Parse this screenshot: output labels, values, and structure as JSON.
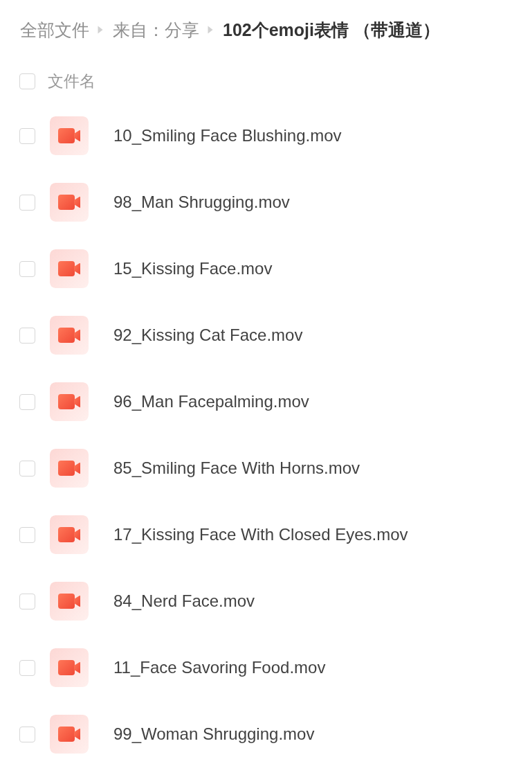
{
  "breadcrumb": [
    {
      "label": "全部文件",
      "current": false
    },
    {
      "label": "来自：分享",
      "current": false
    },
    {
      "label": "102个emoji表情 （带通道）",
      "current": true
    }
  ],
  "header": {
    "checked": false,
    "label": "文件名"
  },
  "files": [
    {
      "name": "10_Smiling Face Blushing.mov",
      "checked": false
    },
    {
      "name": "98_Man Shrugging.mov",
      "checked": false
    },
    {
      "name": "15_Kissing Face.mov",
      "checked": false
    },
    {
      "name": "92_Kissing Cat Face.mov",
      "checked": false
    },
    {
      "name": "96_Man Facepalming.mov",
      "checked": false
    },
    {
      "name": "85_Smiling Face With Horns.mov",
      "checked": false
    },
    {
      "name": "17_Kissing Face With Closed Eyes.mov",
      "checked": false
    },
    {
      "name": "84_Nerd Face.mov",
      "checked": false
    },
    {
      "name": "11_Face Savoring Food.mov",
      "checked": false
    },
    {
      "name": "99_Woman Shrugging.mov",
      "checked": false
    }
  ]
}
